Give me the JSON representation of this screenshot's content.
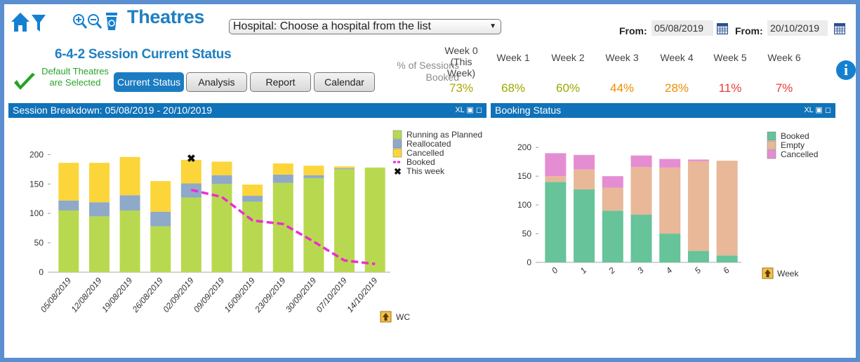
{
  "app": {
    "title": "Theatres",
    "subtitle": "6-4-2 Session Current Status",
    "default_selected": "Default Theatres are Selected"
  },
  "toolbar": {
    "icons": [
      "home-icon",
      "filter-icon",
      "zoom-in-icon",
      "zoom-out-icon",
      "recycle-bin-icon"
    ]
  },
  "hospital_select": {
    "value": "Hospital: Choose a hospital from the list"
  },
  "date_range": {
    "from_label_1": "From:",
    "from_value_1": "05/08/2019",
    "from_label_2": "From:",
    "from_value_2": "20/10/2019"
  },
  "tabs": [
    {
      "label": "Current Status",
      "active": true
    },
    {
      "label": "Analysis",
      "active": false
    },
    {
      "label": "Report",
      "active": false
    },
    {
      "label": "Calendar",
      "active": false
    }
  ],
  "weeks_summary": {
    "label": "% of Sessions Booked",
    "headers": [
      "Week 0 (This Week)",
      "Week 1",
      "Week 2",
      "Week 3",
      "Week 4",
      "Week 5",
      "Week 6"
    ],
    "values": [
      "73%",
      "68%",
      "60%",
      "44%",
      "28%",
      "11%",
      "7%"
    ],
    "colors": [
      "#a8a800",
      "#9aaa00",
      "#9aaa00",
      "#ef8c00",
      "#ef8c00",
      "#ea3a3a",
      "#ea3a3a"
    ]
  },
  "panels": {
    "session_breakdown": {
      "title": "Session Breakdown: 05/08/2019 - 20/10/2019",
      "controls": "XL ▣ ◻"
    },
    "booking_status": {
      "title": "Booking Status",
      "controls": "XL ▣ ◻"
    }
  },
  "chart_data": [
    {
      "type": "bar",
      "stacked": true,
      "categories": [
        "05/08/2019",
        "12/08/2019",
        "19/08/2019",
        "26/08/2019",
        "02/09/2019",
        "09/09/2019",
        "16/09/2019",
        "23/09/2019",
        "30/09/2019",
        "07/10/2019",
        "14/10/2019"
      ],
      "series": [
        {
          "name": "Running as Planned",
          "color": "#b8d94f",
          "values": [
            105,
            95,
            105,
            78,
            127,
            150,
            120,
            152,
            160,
            175,
            178
          ]
        },
        {
          "name": "Reallocated",
          "color": "#8fa9c9",
          "values": [
            17,
            24,
            26,
            25,
            24,
            15,
            10,
            14,
            5,
            2,
            0
          ]
        },
        {
          "name": "Cancelled",
          "color": "#fcd53a",
          "values": [
            64,
            67,
            65,
            52,
            40,
            23,
            19,
            19,
            16,
            3,
            0
          ]
        }
      ],
      "line_series": {
        "name": "Booked",
        "color": "#ee2bd0",
        "start_index": 4,
        "values": [
          140,
          128,
          88,
          82,
          52,
          20,
          14
        ]
      },
      "marker": {
        "name": "This week",
        "index": 4,
        "value": 193
      },
      "ylim": [
        0,
        210
      ],
      "yticks": [
        0,
        50,
        100,
        150,
        200
      ],
      "xlabel": "WC"
    },
    {
      "type": "bar",
      "stacked": true,
      "categories": [
        "0",
        "1",
        "2",
        "3",
        "4",
        "5",
        "6"
      ],
      "series": [
        {
          "name": "Booked",
          "color": "#66c39a",
          "values": [
            140,
            127,
            90,
            83,
            50,
            20,
            12
          ]
        },
        {
          "name": "Empty",
          "color": "#e8b899",
          "values": [
            10,
            35,
            40,
            83,
            115,
            156,
            165
          ]
        },
        {
          "name": "Cancelled",
          "color": "#e58dd3",
          "values": [
            40,
            25,
            20,
            20,
            15,
            3,
            0
          ]
        }
      ],
      "ylim": [
        0,
        210
      ],
      "yticks": [
        0,
        50,
        100,
        150,
        200
      ],
      "xlabel": "Week"
    }
  ]
}
